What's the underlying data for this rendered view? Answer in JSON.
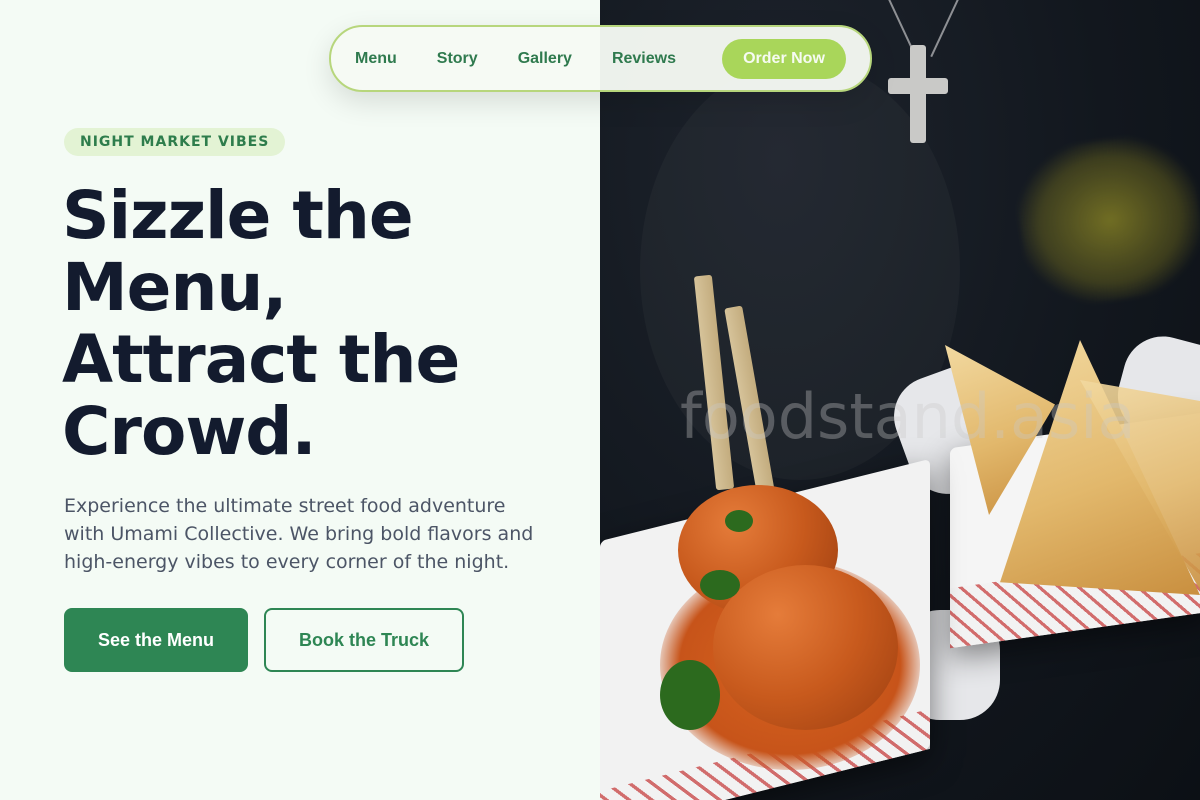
{
  "nav": {
    "links": [
      "Menu",
      "Story",
      "Gallery",
      "Reviews"
    ],
    "cta_label": "Order Now"
  },
  "hero": {
    "badge": "NIGHT MARKET VIBES",
    "headline_lines": [
      "Sizzle the",
      "Menu,",
      "Attract the",
      "Crowd."
    ],
    "subtitle": "Experience the ultimate street food adventure with Umami Collective. We bring bold flavors and high-energy vibes to every corner of the night.",
    "primary_button": "See the Menu",
    "secondary_button": "Book the Truck"
  },
  "image": {
    "watermark": "foodstand.asia",
    "icon": "food-photo"
  },
  "colors": {
    "accent_green": "#2e8654",
    "lime": "#a9d65a",
    "heading": "#131b2e",
    "background": "#f4fbf5"
  }
}
